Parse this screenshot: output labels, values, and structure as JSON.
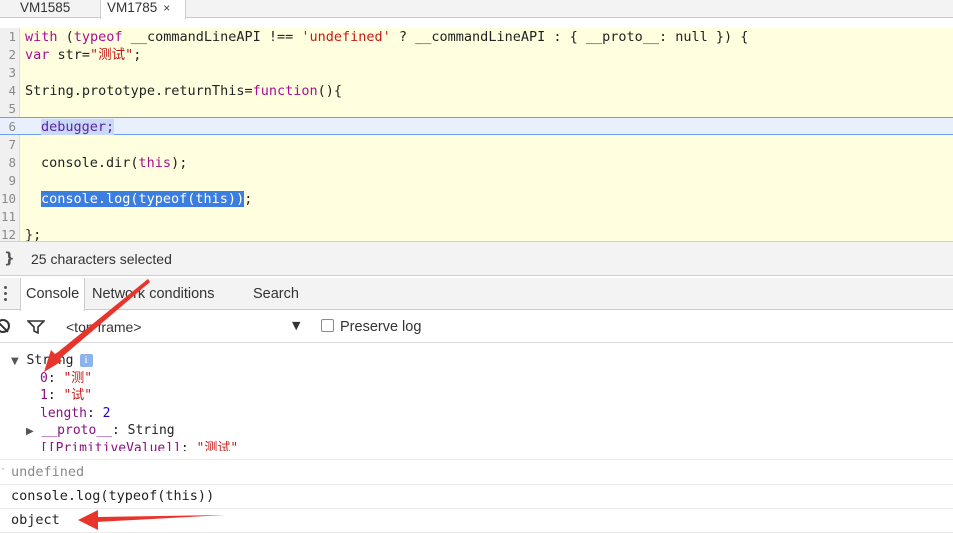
{
  "tabs": [
    {
      "label": "VM1585",
      "active": false
    },
    {
      "label": "VM1785",
      "active": true,
      "close": "×"
    }
  ],
  "editor": {
    "lines": [
      {
        "n": "1"
      },
      {
        "n": "2"
      },
      {
        "n": "3"
      },
      {
        "n": "4"
      },
      {
        "n": "5"
      },
      {
        "n": "6"
      },
      {
        "n": "7"
      },
      {
        "n": "8"
      },
      {
        "n": "9"
      },
      {
        "n": "10"
      },
      {
        "n": "11"
      },
      {
        "n": "12"
      }
    ],
    "l1": {
      "with": "with",
      "paren": " (",
      "typeof": "typeof",
      "rest1": " __commandLineAPI !== ",
      "undef": "'undefined'",
      "rest2": " ? __commandLineAPI : { __proto__: null }) {"
    },
    "l2": {
      "var": "var",
      "rest": " str=",
      "str": "\"测试\"",
      "end": ";"
    },
    "l4": {
      "a": "String.prototype.returnThis=",
      "function": "function",
      "b": "(){"
    },
    "l6": {
      "debugger": "debugger;"
    },
    "l8": {
      "a": "console.dir(",
      "this": "this",
      "b": ");"
    },
    "l10": {
      "sel": "console.log(typeof(this))",
      "end": ";"
    },
    "l12": {
      "code": "};"
    }
  },
  "status": {
    "text": "25 characters selected"
  },
  "drawer": {
    "tabs": [
      "Console",
      "Network conditions",
      "Search"
    ],
    "active_tab": "Console"
  },
  "toolbar": {
    "context": "<top frame>",
    "preserve_log": "Preserve log",
    "preserve_log_checked": false
  },
  "output": {
    "obj": {
      "label": "String",
      "info": "i",
      "props": [
        {
          "key": "0",
          "value": "\"测\""
        },
        {
          "key": "1",
          "value": "\"试\""
        },
        {
          "key": "length",
          "value": "2"
        }
      ],
      "proto_key": "__proto__",
      "proto_value": "String",
      "primitive_key": "[[PrimitiveValue]]",
      "primitive_value": "\"测试\""
    },
    "undefined": "undefined",
    "command": "console.log(typeof(this))",
    "result": "object"
  },
  "colors": {
    "editor_bg": "#ffffdf",
    "selection": "#3b7ee0",
    "annotation_arrow": "#e8352c"
  }
}
